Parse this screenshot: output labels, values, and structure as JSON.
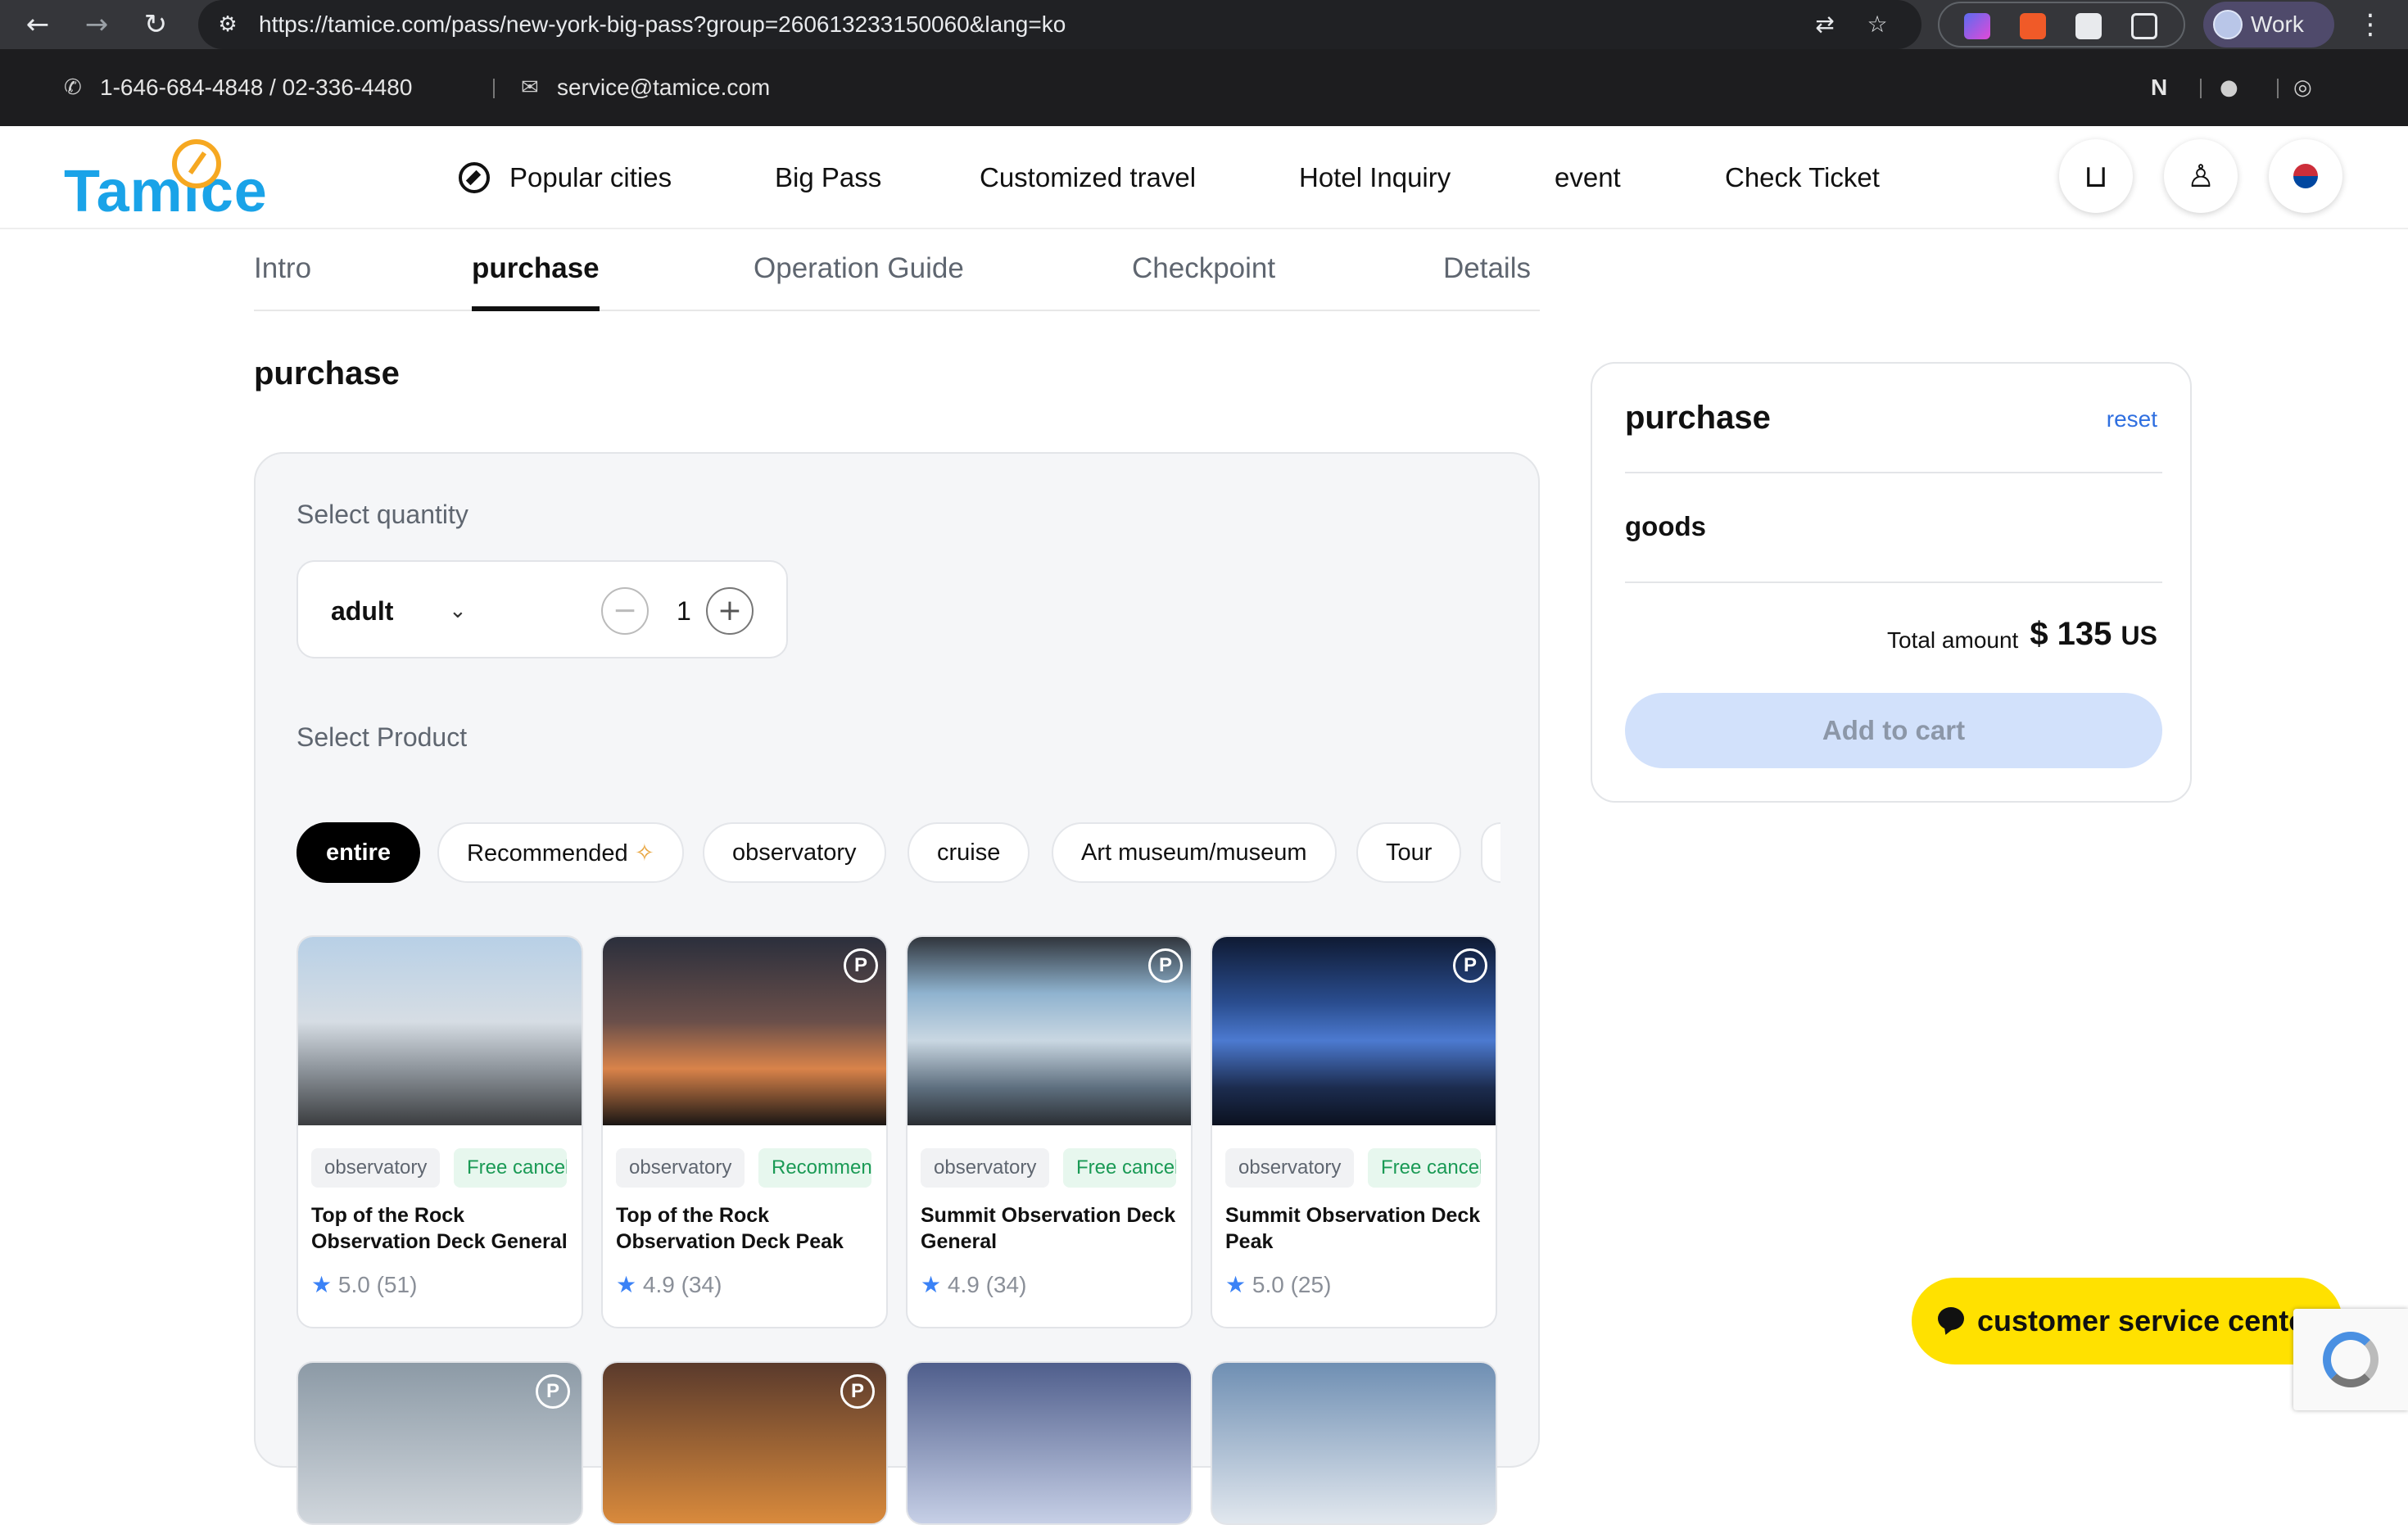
{
  "browser": {
    "url": "https://tamice.com/pass/new-york-big-pass?group=260613233150060&lang=ko",
    "profile_label": "Work"
  },
  "contact_bar": {
    "phone": "1-646-684-4848 / 02-336-4480",
    "email": "service@tamice.com",
    "social_naver": "N"
  },
  "header": {
    "logo": "Tamice",
    "nav": [
      "Popular cities",
      "Big Pass",
      "Customized travel",
      "Hotel Inquiry",
      "event",
      "Check Ticket"
    ],
    "icons": [
      "cart-icon",
      "user-icon",
      "korea-flag-icon"
    ]
  },
  "tabs": [
    "Intro",
    "purchase",
    "Operation Guide",
    "Checkpoint",
    "Details"
  ],
  "active_tab": "purchase",
  "section_title": "purchase",
  "quantity": {
    "label": "Select quantity",
    "type": "adult",
    "value": "1",
    "minus": "−",
    "plus": "+"
  },
  "product": {
    "label": "Select Product",
    "chips": [
      "entire",
      "Recommended",
      "observatory",
      "cruise",
      "Art museum/museum",
      "Tour"
    ],
    "active_chip": "entire",
    "cards": [
      {
        "category": "observatory",
        "badge": "Free cancellation",
        "title": "Top of the Rock Observation Deck General",
        "rating": "5.0",
        "count": "(51)"
      },
      {
        "category": "observatory",
        "badge": "Recommended",
        "title": "Top of the Rock Observation Deck Peak",
        "rating": "4.9",
        "count": "(34)"
      },
      {
        "category": "observatory",
        "badge": "Free cancellation",
        "title": "Summit Observation Deck General",
        "rating": "4.9",
        "count": "(34)"
      },
      {
        "category": "observatory",
        "badge": "Free cancellation",
        "title": "Summit Observation Deck Peak",
        "rating": "5.0",
        "count": "(25)"
      }
    ]
  },
  "summary": {
    "title": "purchase",
    "reset": "reset",
    "goods": "goods",
    "total_label": "Total amount",
    "total_value": "$ 135",
    "currency": "US",
    "add_to_cart": "Add to cart"
  },
  "cs_button": "customer service center",
  "colors": {
    "brand_blue": "#1aa3e8",
    "brand_orange": "#f6a821",
    "cs_yellow": "#ffe100",
    "accent_link": "#2f6fe0"
  }
}
